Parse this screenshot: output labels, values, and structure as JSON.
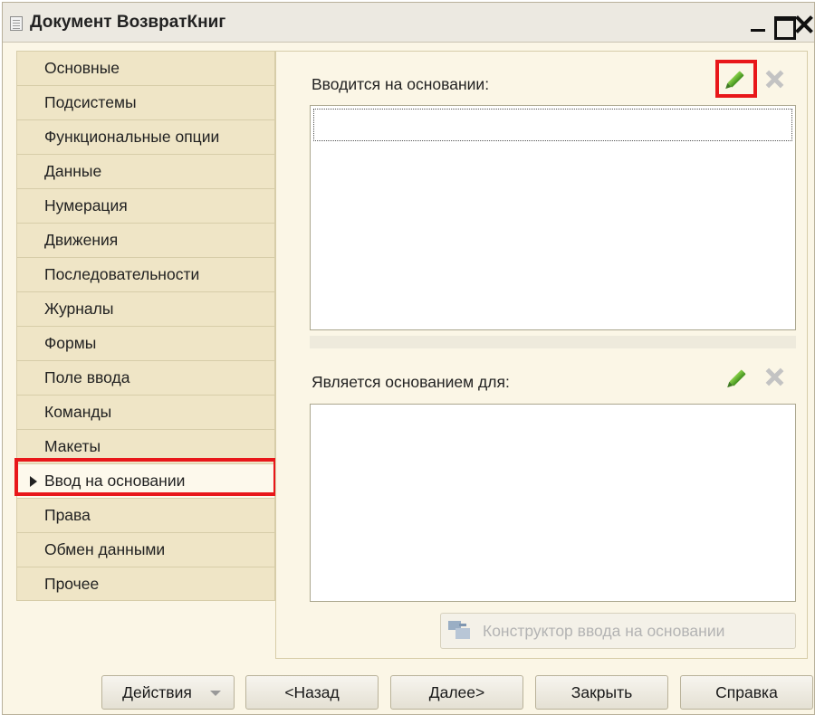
{
  "window": {
    "title": "Документ ВозвратКниг",
    "icon": "document-icon",
    "controls": [
      "minimize-icon",
      "maximize-icon",
      "close-icon"
    ]
  },
  "tabs": [
    {
      "label": "Основные"
    },
    {
      "label": "Подсистемы"
    },
    {
      "label": "Функциональные опции"
    },
    {
      "label": "Данные"
    },
    {
      "label": "Нумерация"
    },
    {
      "label": "Движения"
    },
    {
      "label": "Последовательности"
    },
    {
      "label": "Журналы"
    },
    {
      "label": "Формы"
    },
    {
      "label": "Поле ввода"
    },
    {
      "label": "Команды"
    },
    {
      "label": "Макеты"
    },
    {
      "label": "Ввод на основании"
    },
    {
      "label": "Права"
    },
    {
      "label": "Обмен данными"
    },
    {
      "label": "Прочее"
    }
  ],
  "active_tab": "Ввод на основании",
  "panel": {
    "based_on": {
      "label": "Вводится на основании:",
      "edit_icon": "pencil-icon",
      "clear_icon": "clear-icon",
      "items": []
    },
    "basis_for": {
      "label": "Является основанием для:",
      "edit_icon": "pencil-icon",
      "clear_icon": "clear-icon",
      "items": []
    },
    "constructor_button": "Конструктор ввода на основании"
  },
  "footer": {
    "actions": "Действия",
    "back": "<Назад",
    "next": "Далее>",
    "close": "Закрыть",
    "help": "Справка"
  },
  "colors": {
    "highlight": "#e8171a",
    "tab_bg": "#efe5c6",
    "window_bg": "#fbf6e6",
    "pencil": "#5aae2a"
  }
}
